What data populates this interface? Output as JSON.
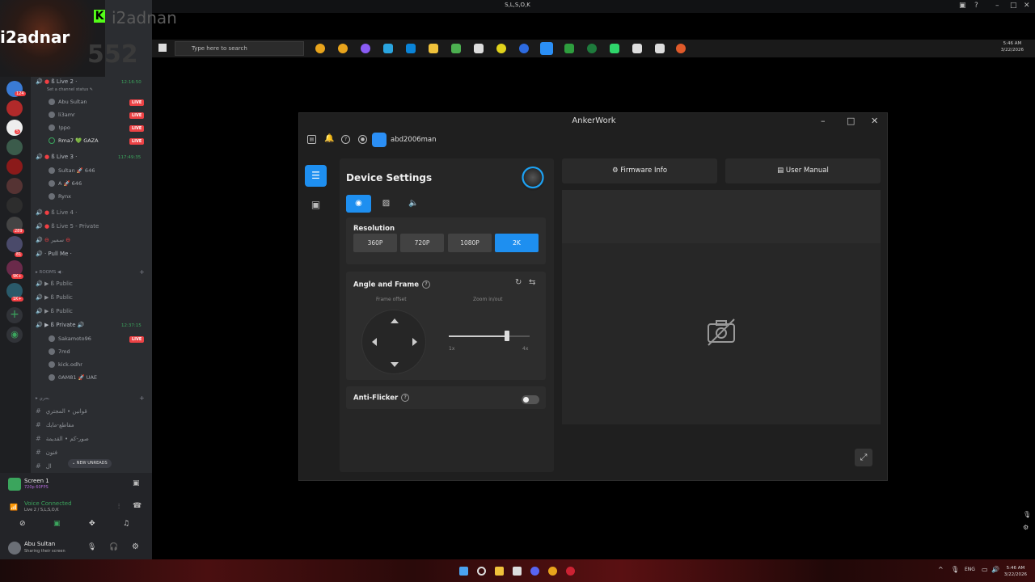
{
  "window": {
    "title": "S,L,S,O,K"
  },
  "stream_overlay": {
    "streamer": "i2adnar",
    "kick_name": "i2adnan",
    "viewers": "552"
  },
  "guild_badges": [
    "124",
    "5",
    "289",
    "81",
    "9K+",
    "1K+"
  ],
  "channels": {
    "voice": [
      {
        "name": "Live 2",
        "time": "12:16:50",
        "status": "Set a channel status",
        "users": [
          {
            "name": "Abu Sultan",
            "live": "LIVE"
          },
          {
            "name": "li3amr",
            "live": "LIVE"
          },
          {
            "name": "!ppo",
            "live": "LIVE"
          },
          {
            "name": "Rma7 💚 GAZA",
            "live": "LIVE"
          }
        ]
      },
      {
        "name": "Live 3",
        "time": "117:49:35",
        "users": [
          {
            "name": "Sultan 🚀 646"
          },
          {
            "name": "A 🚀 646"
          },
          {
            "name": "Rynx"
          }
        ]
      },
      {
        "name": "Live 4"
      },
      {
        "name": "Live 5 - Private"
      },
      {
        "name": "سمير"
      },
      {
        "name": "Pull Me"
      }
    ],
    "rooms_category": "ROOMS",
    "rooms": [
      {
        "name": "Public"
      },
      {
        "name": "Public"
      },
      {
        "name": "Public"
      },
      {
        "name": "Private",
        "time": "12:37:15",
        "users": [
          {
            "name": "Sakamoto96",
            "live": "LIVE"
          },
          {
            "name": "7md"
          },
          {
            "name": "kick.odhr"
          },
          {
            "name": "0AM81 🚀 UAE"
          }
        ]
      }
    ],
    "text_category": "بحري",
    "text": [
      "قوانين • المجتري",
      "مقاطع-مايك",
      "صور-كم • القديمة",
      "فنون",
      "ال"
    ],
    "new_unreads": "NEW UNREADS"
  },
  "screen_panel": {
    "title": "Screen 1",
    "subtitle": "720p 60FPS",
    "voice": "Voice Connected",
    "voice_sub": "Live 2 / S,L,S,O,K"
  },
  "user_panel": {
    "name": "Abu Sultan",
    "status": "Sharing their screen"
  },
  "desktop": {
    "search_placeholder": "Type here to search",
    "time": "5:46 AM",
    "date": "3/22/2026"
  },
  "anker": {
    "title": "AnkerWork",
    "username": "abd2006man",
    "device_settings": "Device Settings",
    "resolution": {
      "title": "Resolution",
      "options": [
        "360P",
        "720P",
        "1080P",
        "2K"
      ],
      "selected": "2K"
    },
    "angle": {
      "title": "Angle and Frame",
      "frame_offset": "Frame offset",
      "zoom": "Zoom in/out",
      "min": "1x",
      "max": "4x",
      "zoom_fraction": 0.72
    },
    "anti_flicker": {
      "title": "Anti-Flicker",
      "enabled": false
    },
    "firmware": "Firmware Info",
    "manual": "User Manual"
  },
  "taskbar": {
    "lang": "ENG",
    "time": "5:46 AM",
    "date": "3/22/2026"
  },
  "colors": {
    "accent": "#1e8ff0",
    "live": "#ed4245",
    "voice_green": "#3ba55d"
  }
}
